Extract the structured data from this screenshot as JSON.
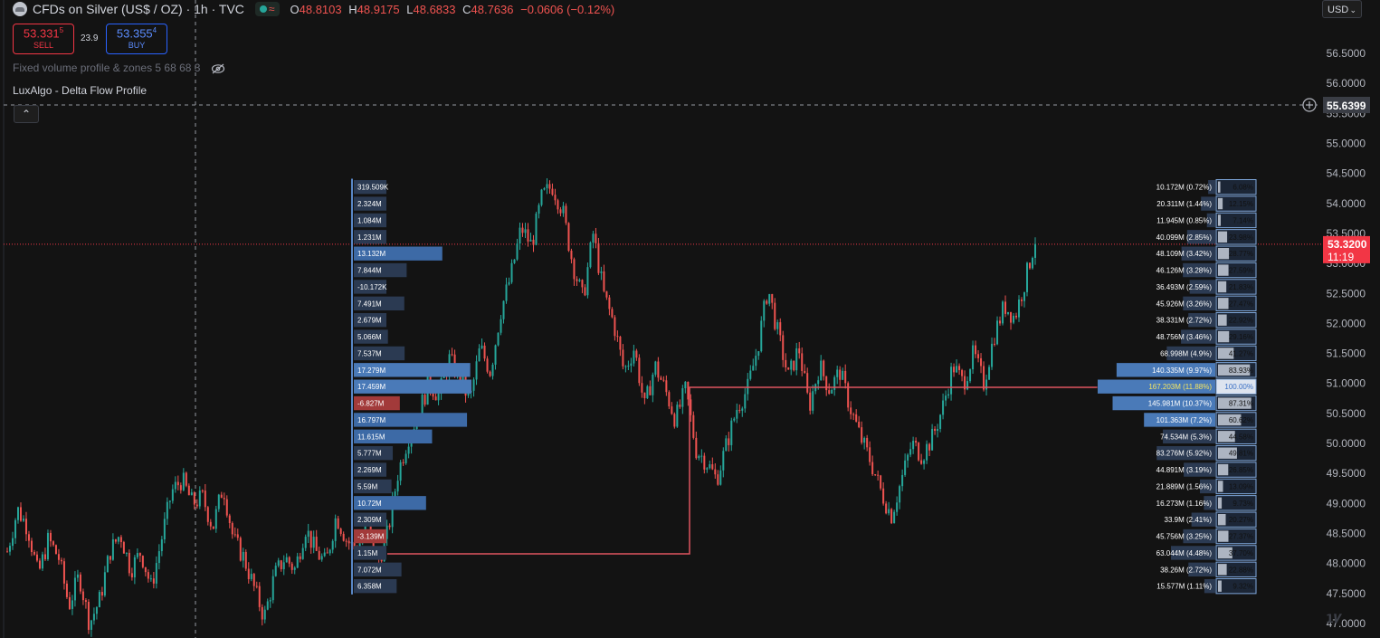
{
  "header": {
    "symbol": "CFDs on Silver (US$ / OZ) · 1h · TVC",
    "ohlc": [
      {
        "k": "O",
        "v": "48.8103"
      },
      {
        "k": "H",
        "v": "48.9175"
      },
      {
        "k": "L",
        "v": "48.6833"
      },
      {
        "k": "C",
        "v": "48.7636"
      },
      {
        "k": "",
        "v": "−0.0606 (−0.12%)"
      }
    ]
  },
  "trade": {
    "sell_price": "53.331",
    "sell_sup": "5",
    "sell_label": "SELL",
    "spread": "23.9",
    "buy_price": "53.355",
    "buy_sup": "4",
    "buy_label": "BUY"
  },
  "indicators": {
    "fixed_volume": "Fixed volume profile & zones 5 68 68 3",
    "delta_flow": "LuxAlgo - Delta Flow Profile",
    "collapse": "⌃"
  },
  "currency": "USD",
  "price_axis": {
    "ticks": [
      "56.5000",
      "56.0000",
      "55.5000",
      "55.0000",
      "54.5000",
      "54.0000",
      "53.5000",
      "53.0000",
      "52.5000",
      "52.0000",
      "51.5000",
      "51.0000",
      "50.5000",
      "50.0000",
      "49.5000",
      "49.0000",
      "48.5000",
      "48.0000",
      "47.5000",
      "47.0000"
    ],
    "crosshair_price": "55.6399",
    "last_price": "53.3200",
    "countdown": "11:19"
  },
  "colors": {
    "bull": "#26a69a",
    "bear": "#ef5350",
    "profile_blue": "#3d6aa6",
    "profile_red": "#a23a3a",
    "poc_line": "#e05560",
    "accent": "#f23645"
  },
  "delta_profile": [
    {
      "label": "319.509K",
      "value": 0.3195
    },
    {
      "label": "2.324M",
      "value": 2.324
    },
    {
      "label": "1.084M",
      "value": 1.084
    },
    {
      "label": "1.231M",
      "value": 1.231
    },
    {
      "label": "13.132M",
      "value": 13.132
    },
    {
      "label": "7.844M",
      "value": 7.844
    },
    {
      "label": "-10.172K",
      "value": -0.0102
    },
    {
      "label": "7.491M",
      "value": 7.491
    },
    {
      "label": "2.679M",
      "value": 2.679
    },
    {
      "label": "5.066M",
      "value": 5.066
    },
    {
      "label": "7.537M",
      "value": 7.537
    },
    {
      "label": "17.279M",
      "value": 17.279
    },
    {
      "label": "17.459M",
      "value": 17.459
    },
    {
      "label": "-6.827M",
      "value": -6.827
    },
    {
      "label": "16.797M",
      "value": 16.797
    },
    {
      "label": "11.615M",
      "value": 11.615
    },
    {
      "label": "5.777M",
      "value": 5.777
    },
    {
      "label": "2.269M",
      "value": 2.269
    },
    {
      "label": "5.59M",
      "value": 5.59
    },
    {
      "label": "10.72M",
      "value": 10.72
    },
    {
      "label": "2.309M",
      "value": 2.309
    },
    {
      "label": "-3.139M",
      "value": -3.139
    },
    {
      "label": "1.15M",
      "value": 1.15
    },
    {
      "label": "7.072M",
      "value": 7.072
    },
    {
      "label": "6.358M",
      "value": 6.358
    }
  ],
  "volume_profile": [
    {
      "vol": "10.172M (0.72%)",
      "pct": "6.08%",
      "p": 6.08
    },
    {
      "vol": "20.311M (1.44%)",
      "pct": "12.15%",
      "p": 12.15
    },
    {
      "vol": "11.945M (0.85%)",
      "pct": "7.14%",
      "p": 7.14
    },
    {
      "vol": "40.099M (2.85%)",
      "pct": "23.98%",
      "p": 23.98
    },
    {
      "vol": "48.109M (3.42%)",
      "pct": "28.77%",
      "p": 28.77
    },
    {
      "vol": "46.126M (3.28%)",
      "pct": "27.59%",
      "p": 27.59
    },
    {
      "vol": "36.493M (2.59%)",
      "pct": "21.83%",
      "p": 21.83
    },
    {
      "vol": "45.926M (3.26%)",
      "pct": "27.47%",
      "p": 27.47
    },
    {
      "vol": "38.331M (2.72%)",
      "pct": "22.92%",
      "p": 22.92
    },
    {
      "vol": "48.756M (3.46%)",
      "pct": "29.16%",
      "p": 29.16
    },
    {
      "vol": "68.998M (4.9%)",
      "pct": "41.27%",
      "p": 41.27
    },
    {
      "vol": "140.335M (9.97%)",
      "pct": "83.93%",
      "p": 83.93
    },
    {
      "vol": "167.203M (11.88%)",
      "pct": "100.00%",
      "p": 100
    },
    {
      "vol": "145.981M (10.37%)",
      "pct": "87.31%",
      "p": 87.31
    },
    {
      "vol": "101.363M (7.2%)",
      "pct": "60.62%",
      "p": 60.62
    },
    {
      "vol": "74.534M (5.3%)",
      "pct": "44.58%",
      "p": 44.58
    },
    {
      "vol": "83.276M (5.92%)",
      "pct": "49.81%",
      "p": 49.81
    },
    {
      "vol": "44.891M (3.19%)",
      "pct": "26.85%",
      "p": 26.85
    },
    {
      "vol": "21.889M (1.56%)",
      "pct": "13.09%",
      "p": 13.09
    },
    {
      "vol": "16.273M (1.16%)",
      "pct": "9.73%",
      "p": 9.73
    },
    {
      "vol": "33.9M (2.41%)",
      "pct": "20.27%",
      "p": 20.27
    },
    {
      "vol": "45.756M (3.25%)",
      "pct": "27.37%",
      "p": 27.37
    },
    {
      "vol": "63.044M (4.48%)",
      "pct": "37.70%",
      "p": 37.7
    },
    {
      "vol": "38.26M (2.72%)",
      "pct": "22.88%",
      "p": 22.88
    },
    {
      "vol": "15.577M (1.11%)",
      "pct": "9.32%",
      "p": 9.32
    }
  ],
  "price_path": [
    48.2,
    48.9,
    48.6,
    47.8,
    48.4,
    48.1,
    47.3,
    47.8,
    47.0,
    47.4,
    48.2,
    48.5,
    47.9,
    48.2,
    47.6,
    48.4,
    49.2,
    49.4,
    49.0,
    49.1,
    48.6,
    49.3,
    48.4,
    48.1,
    47.6,
    47.1,
    47.8,
    48.1,
    47.9,
    48.6,
    48.2,
    48.0,
    48.8,
    48.4,
    48.2,
    48.7,
    48.0,
    48.5,
    49.5,
    50.1,
    50.5,
    51.0,
    50.8,
    51.4,
    51.1,
    50.7,
    51.6,
    51.2,
    52.2,
    52.8,
    53.6,
    53.3,
    54.1,
    54.3,
    53.9,
    53.0,
    52.4,
    53.5,
    52.5,
    52.0,
    51.2,
    51.6,
    50.6,
    51.3,
    50.9,
    50.4,
    50.9,
    49.9,
    49.7,
    49.4,
    50.0,
    50.6,
    50.9,
    51.6,
    52.6,
    51.8,
    51.1,
    51.6,
    50.6,
    51.3,
    50.9,
    51.2,
    50.6,
    50.1,
    49.7,
    49.2,
    48.8,
    49.4,
    50.0,
    49.8,
    50.1,
    50.6,
    51.3,
    51.0,
    51.5,
    51.0,
    51.8,
    52.3,
    52.1,
    52.7,
    53.4
  ]
}
